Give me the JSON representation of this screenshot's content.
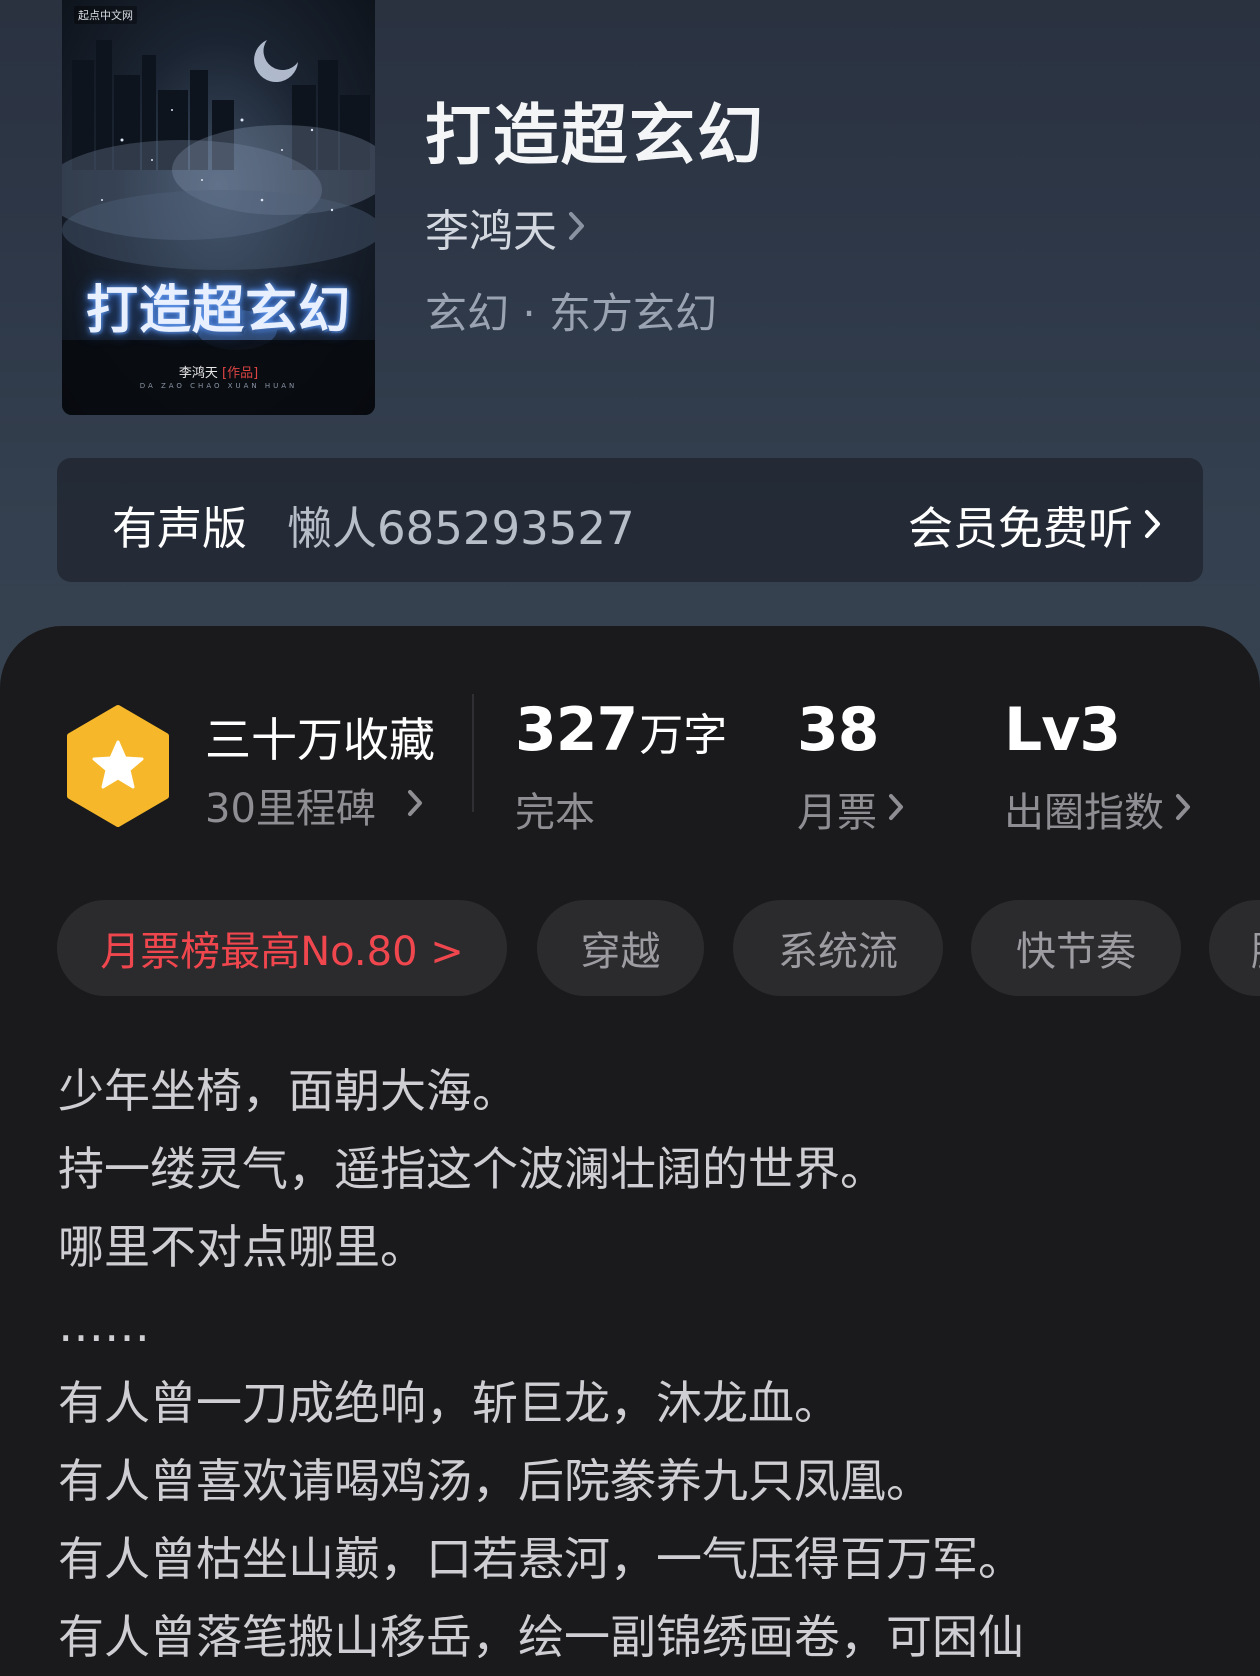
{
  "cover": {
    "publisher_badge": "起点中文网",
    "title_art": "打造超玄幻",
    "author_art": "李鸿天",
    "author_tag": "[作品]",
    "pinyin": "DA ZAO CHAO XUAN HUAN"
  },
  "book": {
    "title": "打造超玄幻",
    "author": "李鸿天",
    "genre": "玄幻 · 东方玄幻"
  },
  "audio": {
    "label": "有声版",
    "narrator": "懒人685293527",
    "cta": "会员免费听"
  },
  "stats": {
    "favorites_title": "三十万收藏",
    "favorites_sub": "30里程碑",
    "words_value": "327",
    "words_unit": "万字",
    "words_label": "完本",
    "tickets_value": "38",
    "tickets_label": "月票",
    "index_value": "Lv3",
    "index_label": "出圈指数"
  },
  "tags": {
    "rank": "月票榜最高No.80 >",
    "items": [
      "穿越",
      "系统流",
      "快节奏",
      "脑"
    ]
  },
  "synopsis": [
    "少年坐椅，面朝大海。",
    "持一缕灵气，遥指这个波澜壮阔的世界。",
    "哪里不对点哪里。",
    "……",
    "有人曾一刀成绝响，斩巨龙，沐龙血。",
    "有人曾喜欢请喝鸡汤，后院豢养九只凤凰。",
    "有人曾枯坐山巅，口若悬河，一气压得百万军。",
    "有人曾落笔搬山移岳，绘一副锦绣画卷，可困仙"
  ],
  "colors": {
    "hero_bg": "#2e3848",
    "panel_bg": "#1a1a1c",
    "rank_red": "#f0464e",
    "badge_gold": "#f6b82a"
  },
  "icons": {
    "chevron": "chevron-right-icon",
    "badge": "star-hexagon-icon"
  }
}
